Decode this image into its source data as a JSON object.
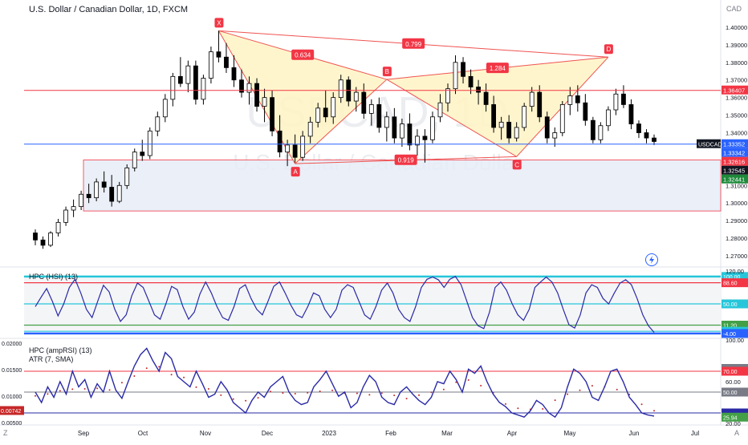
{
  "header": {
    "symbol_title": "U.S. Dollar / Canadian Dollar, 1D, FXCM",
    "currency": "CAD",
    "watermark_symbol": "USDCAD, 1D",
    "watermark_name": "U.S. Dollar / Canadian Dollar"
  },
  "corner_labels": {
    "left": "Z",
    "right": "A"
  },
  "colors": {
    "candle": "#000000",
    "h_red": "#f23645",
    "h_blue": "#2962ff",
    "pattern_line": "#ef5350",
    "pattern_fill": "#fff3c4",
    "zone_fill": "#e6ecf7",
    "hsi_line": "#2a2aa6",
    "hsi_band_cyan": "#26c6da",
    "hsi_band_green": "#43a047",
    "amprsi_line": "#2a2aa6",
    "atr_dots": "#c62828"
  },
  "chart_data": [
    {
      "type": "candlestick",
      "title": "U.S. Dollar / Canadian Dollar, 1D, FXCM",
      "y_unit": "CAD",
      "ylim": [
        1.265,
        1.41
      ],
      "yticks": [
        "1.40000",
        "1.39000",
        "1.38000",
        "1.37000",
        "1.36000",
        "1.35000",
        "1.34000",
        "1.33000",
        "1.32000",
        "1.31000",
        "1.30000",
        "1.29000",
        "1.28000",
        "1.27000"
      ],
      "x_labels": [
        "Sep",
        "Oct",
        "Nov",
        "Dec",
        "2023",
        "Feb",
        "Mar",
        "Apr",
        "May",
        "Jun",
        "Jul"
      ],
      "ohlc": [
        [
          1.283,
          1.285,
          1.276,
          1.279
        ],
        [
          1.279,
          1.281,
          1.274,
          1.276
        ],
        [
          1.276,
          1.284,
          1.275,
          1.283
        ],
        [
          1.283,
          1.291,
          1.281,
          1.289
        ],
        [
          1.289,
          1.298,
          1.287,
          1.296
        ],
        [
          1.296,
          1.302,
          1.292,
          1.298
        ],
        [
          1.298,
          1.307,
          1.296,
          1.305
        ],
        [
          1.305,
          1.311,
          1.3,
          1.303
        ],
        [
          1.303,
          1.314,
          1.301,
          1.312
        ],
        [
          1.312,
          1.318,
          1.306,
          1.309
        ],
        [
          1.309,
          1.316,
          1.298,
          1.301
        ],
        [
          1.301,
          1.312,
          1.3,
          1.31
        ],
        [
          1.31,
          1.322,
          1.308,
          1.32
        ],
        [
          1.32,
          1.331,
          1.318,
          1.329
        ],
        [
          1.329,
          1.336,
          1.324,
          1.327
        ],
        [
          1.327,
          1.343,
          1.325,
          1.341
        ],
        [
          1.341,
          1.352,
          1.338,
          1.349
        ],
        [
          1.349,
          1.362,
          1.346,
          1.359
        ],
        [
          1.359,
          1.374,
          1.355,
          1.372
        ],
        [
          1.372,
          1.383,
          1.366,
          1.368
        ],
        [
          1.368,
          1.381,
          1.363,
          1.378
        ],
        [
          1.378,
          1.381,
          1.356,
          1.359
        ],
        [
          1.359,
          1.373,
          1.356,
          1.371
        ],
        [
          1.371,
          1.389,
          1.368,
          1.386
        ],
        [
          1.386,
          1.398,
          1.38,
          1.383
        ],
        [
          1.383,
          1.391,
          1.374,
          1.377
        ],
        [
          1.377,
          1.384,
          1.366,
          1.37
        ],
        [
          1.37,
          1.376,
          1.36,
          1.363
        ],
        [
          1.363,
          1.372,
          1.356,
          1.368
        ],
        [
          1.368,
          1.371,
          1.352,
          1.355
        ],
        [
          1.355,
          1.365,
          1.346,
          1.36
        ],
        [
          1.36,
          1.364,
          1.338,
          1.341
        ],
        [
          1.341,
          1.35,
          1.326,
          1.329
        ],
        [
          1.329,
          1.336,
          1.321,
          1.333
        ],
        [
          1.333,
          1.339,
          1.323,
          1.326
        ],
        [
          1.326,
          1.341,
          1.324,
          1.338
        ],
        [
          1.338,
          1.349,
          1.334,
          1.346
        ],
        [
          1.346,
          1.357,
          1.343,
          1.354
        ],
        [
          1.354,
          1.364,
          1.346,
          1.349
        ],
        [
          1.349,
          1.363,
          1.345,
          1.36
        ],
        [
          1.36,
          1.373,
          1.357,
          1.37
        ],
        [
          1.37,
          1.372,
          1.355,
          1.358
        ],
        [
          1.358,
          1.366,
          1.352,
          1.363
        ],
        [
          1.363,
          1.368,
          1.348,
          1.351
        ],
        [
          1.351,
          1.359,
          1.344,
          1.356
        ],
        [
          1.356,
          1.36,
          1.34,
          1.343
        ],
        [
          1.343,
          1.352,
          1.335,
          1.349
        ],
        [
          1.349,
          1.354,
          1.334,
          1.337
        ],
        [
          1.337,
          1.348,
          1.332,
          1.345
        ],
        [
          1.345,
          1.351,
          1.33,
          1.333
        ],
        [
          1.333,
          1.342,
          1.327,
          1.338
        ],
        [
          1.338,
          1.342,
          1.323,
          1.336
        ],
        [
          1.336,
          1.352,
          1.334,
          1.349
        ],
        [
          1.349,
          1.362,
          1.346,
          1.357
        ],
        [
          1.357,
          1.368,
          1.352,
          1.365
        ],
        [
          1.365,
          1.384,
          1.362,
          1.38
        ],
        [
          1.38,
          1.383,
          1.368,
          1.372
        ],
        [
          1.372,
          1.376,
          1.362,
          1.366
        ],
        [
          1.366,
          1.37,
          1.356,
          1.363
        ],
        [
          1.363,
          1.368,
          1.352,
          1.356
        ],
        [
          1.356,
          1.361,
          1.34,
          1.343
        ],
        [
          1.343,
          1.349,
          1.336,
          1.346
        ],
        [
          1.346,
          1.35,
          1.334,
          1.337
        ],
        [
          1.337,
          1.346,
          1.335,
          1.343
        ],
        [
          1.343,
          1.357,
          1.341,
          1.355
        ],
        [
          1.355,
          1.366,
          1.352,
          1.363
        ],
        [
          1.363,
          1.367,
          1.346,
          1.349
        ],
        [
          1.349,
          1.352,
          1.334,
          1.337
        ],
        [
          1.337,
          1.343,
          1.332,
          1.34
        ],
        [
          1.34,
          1.358,
          1.338,
          1.356
        ],
        [
          1.356,
          1.366,
          1.35,
          1.361
        ],
        [
          1.361,
          1.367,
          1.352,
          1.357
        ],
        [
          1.357,
          1.362,
          1.344,
          1.347
        ],
        [
          1.347,
          1.349,
          1.334,
          1.336
        ],
        [
          1.336,
          1.346,
          1.334,
          1.344
        ],
        [
          1.344,
          1.355,
          1.341,
          1.353
        ],
        [
          1.353,
          1.365,
          1.35,
          1.362
        ],
        [
          1.362,
          1.367,
          1.354,
          1.356
        ],
        [
          1.356,
          1.359,
          1.342,
          1.345
        ],
        [
          1.345,
          1.347,
          1.337,
          1.34
        ],
        [
          1.34,
          1.342,
          1.334,
          1.337
        ],
        [
          1.337,
          1.339,
          1.333,
          1.335
        ]
      ],
      "horizontal_levels": [
        {
          "value": 1.36407,
          "label": "1.36407",
          "color": "#f23645"
        },
        {
          "value": 1.33352,
          "label": "1.33352",
          "color": "#2962ff"
        }
      ],
      "price_tags": [
        {
          "value": 1.33352,
          "label": "USDCAD",
          "color": "#131722"
        },
        {
          "value": 1.33342,
          "label": "1.33342",
          "color": "#2962ff"
        },
        {
          "value": 1.32616,
          "label": "1.32616",
          "color": "#f23645"
        },
        {
          "value": 1.32545,
          "label": "1.32545",
          "color": "#131722"
        },
        {
          "value": 1.32441,
          "label": "1.32441",
          "color": "#1e8a3a"
        }
      ],
      "zone": {
        "top": 1.3245,
        "bottom": 1.2955
      },
      "harmonic_points": [
        {
          "label": "X",
          "price": 1.398
        },
        {
          "label": "A",
          "price": 1.3224
        },
        {
          "label": "B",
          "price": 1.3703
        },
        {
          "label": "C",
          "price": 1.3264
        },
        {
          "label": "D",
          "price": 1.383
        }
      ],
      "harmonic_ratios": [
        "0.634",
        "0.799",
        "1.284",
        "0.919"
      ]
    },
    {
      "type": "line",
      "title": "HPC (HSI) (13)",
      "ylim": [
        -10,
        110
      ],
      "yticks": [
        "120.00"
      ],
      "levels": [
        {
          "value": 100.0,
          "label": "100.00",
          "color": "#26c6da"
        },
        {
          "value": 88.6,
          "label": "88.60",
          "color": "#f23645"
        },
        {
          "value": 50.0,
          "label": "50.00",
          "color": "#26c6da"
        },
        {
          "value": 11.2,
          "label": "11.20",
          "color": "#43a047"
        },
        {
          "value": 0.0,
          "label": "0.00",
          "color": "#26c6da"
        },
        {
          "value": -4.0,
          "label": "-4.00",
          "color": "#2962ff"
        }
      ],
      "values": [
        45,
        62,
        78,
        55,
        28,
        50,
        80,
        95,
        70,
        40,
        25,
        55,
        84,
        72,
        40,
        18,
        30,
        65,
        88,
        80,
        55,
        30,
        22,
        50,
        82,
        76,
        45,
        22,
        35,
        68,
        90,
        70,
        45,
        25,
        20,
        45,
        78,
        85,
        60,
        40,
        30,
        55,
        82,
        90,
        70,
        48,
        30,
        25,
        45,
        70,
        65,
        40,
        25,
        40,
        75,
        85,
        80,
        55,
        30,
        22,
        45,
        75,
        88,
        70,
        40,
        25,
        18,
        45,
        80,
        95,
        99,
        94,
        80,
        95,
        100,
        85,
        55,
        25,
        10,
        5,
        35,
        80,
        90,
        75,
        50,
        30,
        20,
        40,
        80,
        90,
        99,
        90,
        70,
        40,
        12,
        6,
        30,
        70,
        85,
        80,
        60,
        50,
        70,
        88,
        94,
        85,
        60,
        30,
        10,
        -2
      ]
    },
    {
      "type": "line",
      "title": "HPC (ampRSI) (13)",
      "subtitle": "ATR (7, SMA)",
      "ylim": [
        20,
        100
      ],
      "yticks": [
        "100.00",
        "60.00",
        "20.00"
      ],
      "atr_axis": [
        "0.02000",
        "0.01500",
        "0.01000",
        "0.00500"
      ],
      "levels": [
        {
          "value": 72.7,
          "label": "72.70",
          "color": "#787b86"
        },
        {
          "value": 70.0,
          "label": "70.00",
          "color": "#f23645"
        },
        {
          "value": 50.0,
          "label": "50.00",
          "color": "#787b86"
        },
        {
          "value": 30.0,
          "label": "30.00",
          "color": "#2a2aa6"
        },
        {
          "value": 27.79,
          "label": "27.79",
          "color": "#2a2aa6"
        },
        {
          "value": 25.94,
          "label": "25.94",
          "color": "#43a047"
        }
      ],
      "atr_tag": {
        "value": 0.00742,
        "label": "0.00742",
        "color": "#c62828"
      },
      "values": [
        50,
        40,
        55,
        45,
        60,
        48,
        70,
        55,
        62,
        45,
        58,
        50,
        70,
        52,
        44,
        60,
        75,
        86,
        92,
        80,
        70,
        88,
        82,
        65,
        60,
        55,
        70,
        58,
        45,
        48,
        60,
        52,
        40,
        35,
        30,
        42,
        50,
        45,
        55,
        60,
        65,
        50,
        42,
        38,
        40,
        55,
        62,
        70,
        58,
        46,
        50,
        35,
        40,
        55,
        66,
        60,
        45,
        40,
        38,
        50,
        55,
        48,
        42,
        38,
        45,
        60,
        58,
        70,
        62,
        50,
        72,
        68,
        75,
        60,
        48,
        40,
        36,
        30,
        28,
        26,
        32,
        42,
        38,
        30,
        26,
        35,
        55,
        72,
        68,
        60,
        45,
        42,
        55,
        70,
        72,
        60,
        45,
        38,
        30,
        28,
        27
      ]
    }
  ],
  "pane_labels": {
    "pane1": "HPC (HSI) (13)",
    "pane2_a": "HPC (ampRSI) (13)",
    "pane2_b": "ATR (7, SMA)"
  },
  "top_axis_label": "CAD"
}
